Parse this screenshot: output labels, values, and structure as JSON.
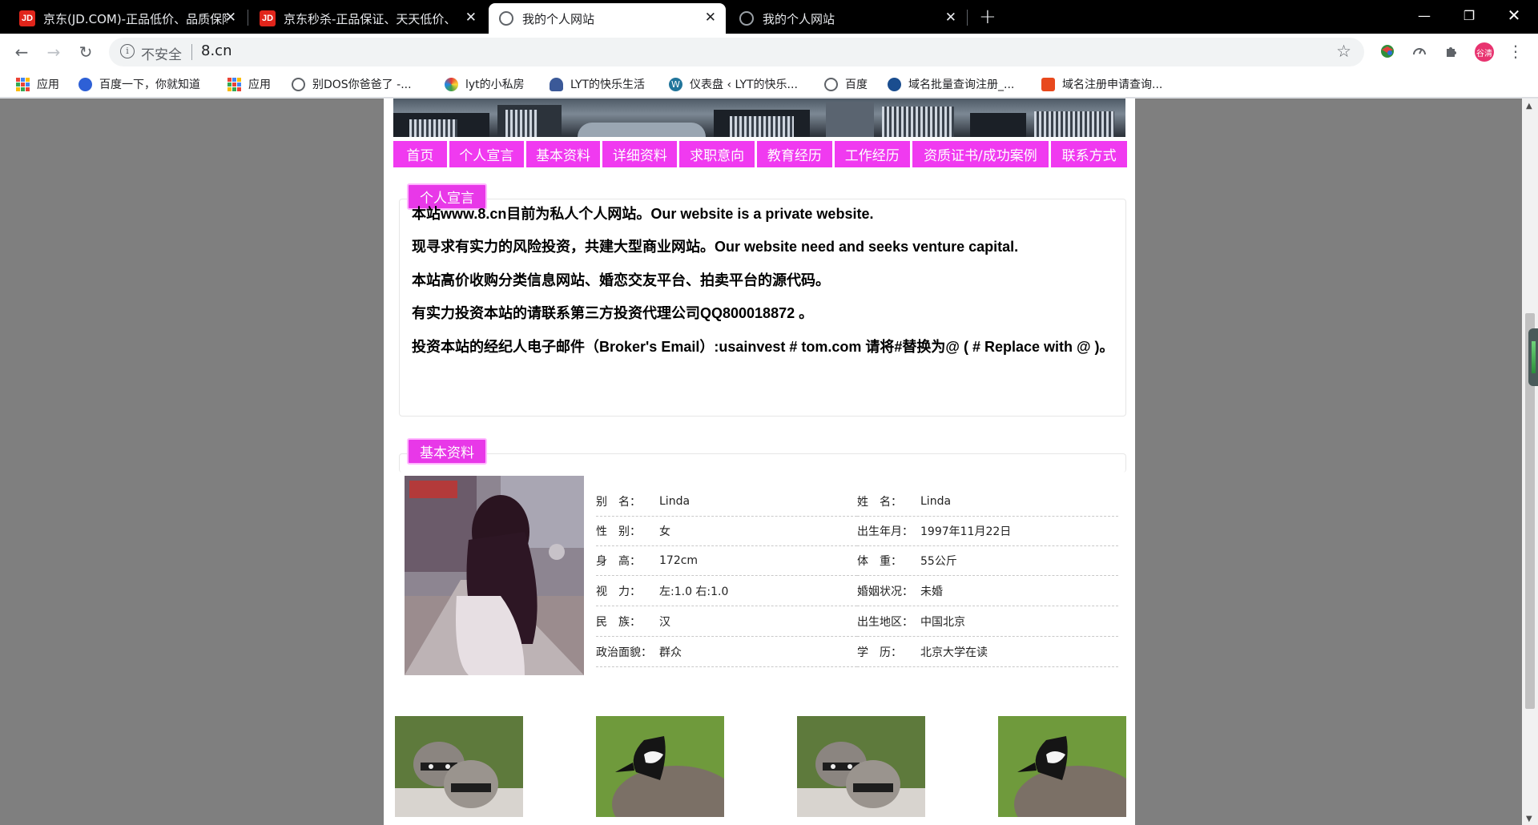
{
  "browser": {
    "tabs": [
      {
        "title": "京东(JD.COM)-正品低价、品质保障",
        "icon": "jd-icon",
        "active": false
      },
      {
        "title": "京东秒杀-正品保证、天天低价、",
        "icon": "jd-icon",
        "active": false
      },
      {
        "title": "我的个人网站",
        "icon": "globe-icon",
        "active": true
      },
      {
        "title": "我的个人网站",
        "icon": "globe-icon",
        "active": false
      }
    ],
    "security_label": "不安全",
    "url": "8.cn",
    "profile_initials": "谷清",
    "bookmarks": [
      "应用",
      "百度一下，你就知道",
      "应用",
      "别DOS你爸爸了 -...",
      "lyt的小私房",
      "LYT的快乐生活",
      "仪表盘 ‹ LYT的快乐...",
      "百度",
      "域名批量查询注册_...",
      "域名注册申请查询..."
    ]
  },
  "site": {
    "nav": [
      "首页",
      "个人宣言",
      "基本资料",
      "详细资料",
      "求职意向",
      "教育经历",
      "工作经历",
      "资质证书/成功案例",
      "联系方式"
    ],
    "declaration": {
      "tag": "个人宣言",
      "lines": [
        "本站www.8.cn目前为私人个人网站。Our website is a private website.",
        "现寻求有实力的风险投资，共建大型商业网站。Our website need and seeks venture capital.",
        "本站高价收购分类信息网站、婚恋交友平台、拍卖平台的源代码。",
        "有实力投资本站的请联系第三方投资代理公司QQ800018872 。",
        "投资本站的经纪人电子邮件（Broker's Email）:usainvest # tom.com 请将#替换为@ ( # Replace with @ )。"
      ]
    },
    "basic": {
      "tag": "基本资料",
      "left": [
        {
          "label": "别　名：",
          "value": "Linda"
        },
        {
          "label": "性　别：",
          "value": "女"
        },
        {
          "label": "身　高：",
          "value": "172cm"
        },
        {
          "label": "视　力：",
          "value": "左:1.0 右:1.0"
        },
        {
          "label": "民　族：",
          "value": "汉"
        },
        {
          "label": "政治面貌：",
          "value": "群众"
        }
      ],
      "right": [
        {
          "label": "姓　名：",
          "value": "Linda"
        },
        {
          "label": "出生年月：",
          "value": "1997年11月22日"
        },
        {
          "label": "体　重：",
          "value": "55公斤"
        },
        {
          "label": "婚姻状况：",
          "value": "未婚"
        },
        {
          "label": "出生地区：",
          "value": "中国北京"
        },
        {
          "label": "学　历：",
          "value": "北京大学在读"
        }
      ]
    },
    "gallery": [
      "raccoon-photo",
      "goose-photo",
      "raccoon-photo",
      "goose-photo"
    ]
  }
}
